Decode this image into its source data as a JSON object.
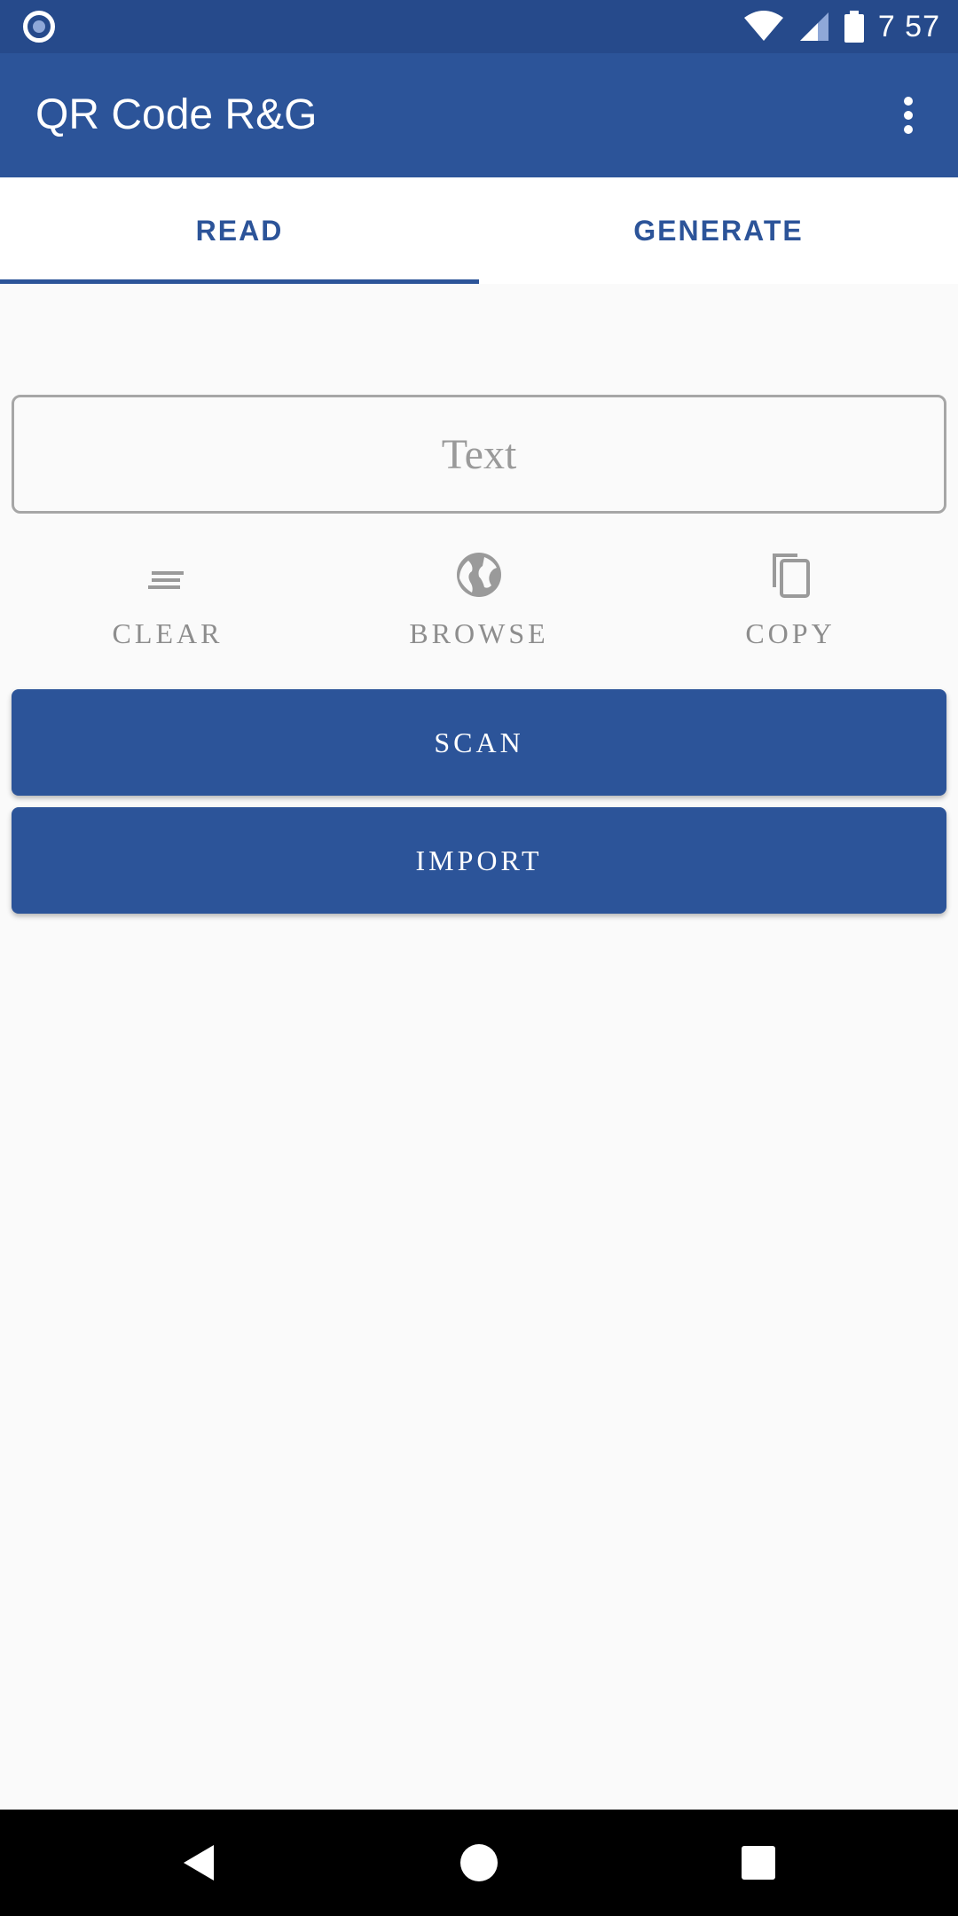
{
  "status_bar": {
    "time": "7 57",
    "icons": [
      "notification-dot-icon",
      "wifi-icon",
      "cellular-signal-icon",
      "battery-icon"
    ]
  },
  "app_bar": {
    "title": "QR Code R&G",
    "menu_icon": "more-vert-icon"
  },
  "tabs": [
    {
      "label": "READ",
      "selected": true
    },
    {
      "label": "GENERATE",
      "selected": false
    }
  ],
  "input": {
    "placeholder": "Text",
    "value": ""
  },
  "actions": [
    {
      "label": "CLEAR",
      "icon": "clear-lines-icon"
    },
    {
      "label": "BROWSE",
      "icon": "globe-icon"
    },
    {
      "label": "COPY",
      "icon": "copy-icon"
    }
  ],
  "buttons": {
    "scan": "SCAN",
    "import": "IMPORT"
  },
  "colors": {
    "primary": "#2c5499",
    "status_bar": "#264a8b",
    "muted_text": "#8d8d8d",
    "background": "#fafafa"
  },
  "nav_bar": {
    "icons": [
      "back-icon",
      "home-icon",
      "recents-icon"
    ]
  }
}
